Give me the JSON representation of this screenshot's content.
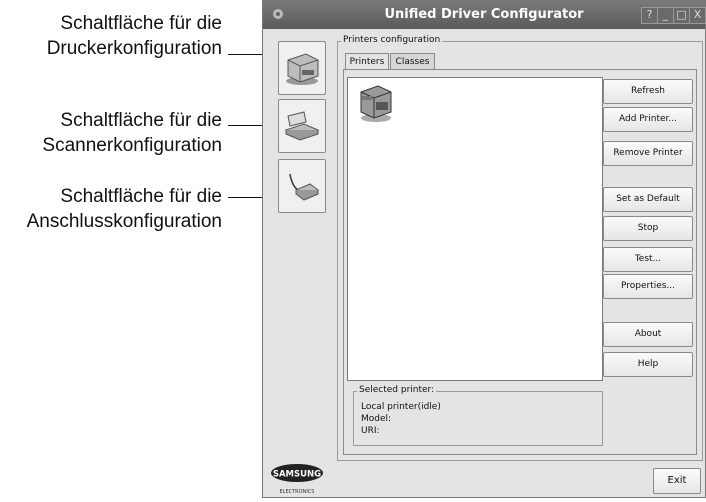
{
  "callouts": [
    {
      "line1": "Schaltfläche für die",
      "line2": "Druckerkonfiguration"
    },
    {
      "line1": "Schaltfläche für die",
      "line2": "Scannerkonfiguration"
    },
    {
      "line1": "Schaltfläche für die",
      "line2": "Anschlusskonfiguration"
    }
  ],
  "window": {
    "title": "Unified Driver Configurator",
    "title_buttons": {
      "help": "?",
      "minimize": "_",
      "maximize": "□",
      "close": "X"
    }
  },
  "sidebar": {
    "items": [
      {
        "icon": "printer-icon"
      },
      {
        "icon": "scanner-icon"
      },
      {
        "icon": "port-icon"
      }
    ],
    "logo": {
      "brand": "SAMSUNG",
      "sub": "ELECTRONICS"
    }
  },
  "printers_group": {
    "legend": "Printers configuration",
    "tabs": [
      {
        "label": "Printers",
        "active": true
      },
      {
        "label": "Classes",
        "active": false
      }
    ]
  },
  "buttons": {
    "refresh": "Refresh",
    "add_printer": "Add Printer...",
    "remove_printer": "Remove Printer",
    "set_default": "Set as Default",
    "stop": "Stop",
    "test": "Test...",
    "properties": "Properties...",
    "about": "About",
    "help": "Help",
    "exit": "Exit"
  },
  "selected_printer": {
    "legend": "Selected printer:",
    "status": "Local printer(idle)",
    "model": "Model:",
    "uri": "URI:"
  }
}
